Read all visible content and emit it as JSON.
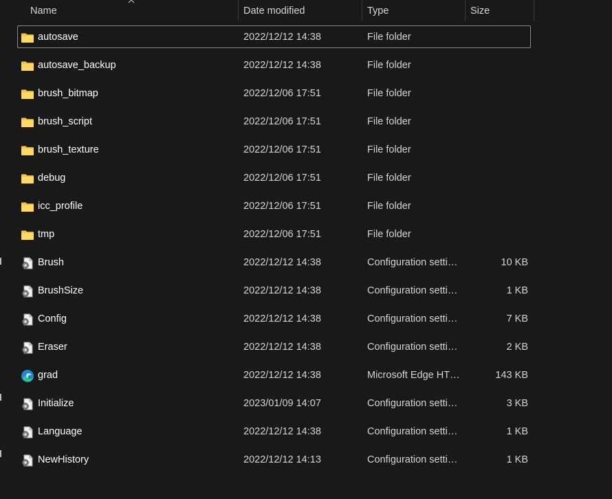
{
  "columns": {
    "name": "Name",
    "date": "Date modified",
    "type": "Type",
    "size": "Size"
  },
  "files": [
    {
      "name": "autosave",
      "date": "2022/12/12 14:38",
      "type": "File folder",
      "size": "",
      "icon": "folder-icon",
      "selected": true
    },
    {
      "name": "autosave_backup",
      "date": "2022/12/12 14:38",
      "type": "File folder",
      "size": "",
      "icon": "folder-icon"
    },
    {
      "name": "brush_bitmap",
      "date": "2022/12/06 17:51",
      "type": "File folder",
      "size": "",
      "icon": "folder-icon"
    },
    {
      "name": "brush_script",
      "date": "2022/12/06 17:51",
      "type": "File folder",
      "size": "",
      "icon": "folder-icon"
    },
    {
      "name": "brush_texture",
      "date": "2022/12/06 17:51",
      "type": "File folder",
      "size": "",
      "icon": "folder-icon"
    },
    {
      "name": "debug",
      "date": "2022/12/06 17:51",
      "type": "File folder",
      "size": "",
      "icon": "folder-icon"
    },
    {
      "name": "icc_profile",
      "date": "2022/12/06 17:51",
      "type": "File folder",
      "size": "",
      "icon": "folder-icon"
    },
    {
      "name": "tmp",
      "date": "2022/12/06 17:51",
      "type": "File folder",
      "size": "",
      "icon": "folder-icon"
    },
    {
      "name": "Brush",
      "date": "2022/12/12 14:38",
      "type": "Configuration setti…",
      "size": "10 KB",
      "icon": "config-settings-icon"
    },
    {
      "name": "BrushSize",
      "date": "2022/12/12 14:38",
      "type": "Configuration setti…",
      "size": "1 KB",
      "icon": "config-settings-icon"
    },
    {
      "name": "Config",
      "date": "2022/12/12 14:38",
      "type": "Configuration setti…",
      "size": "7 KB",
      "icon": "config-settings-icon"
    },
    {
      "name": "Eraser",
      "date": "2022/12/12 14:38",
      "type": "Configuration setti…",
      "size": "2 KB",
      "icon": "config-settings-icon"
    },
    {
      "name": "grad",
      "date": "2022/12/12 14:38",
      "type": "Microsoft Edge HT…",
      "size": "143 KB",
      "icon": "edge-html-icon"
    },
    {
      "name": "Initialize",
      "date": "2023/01/09 14:07",
      "type": "Configuration setti…",
      "size": "3 KB",
      "icon": "config-settings-icon"
    },
    {
      "name": "Language",
      "date": "2022/12/12 14:38",
      "type": "Configuration setti…",
      "size": "1 KB",
      "icon": "config-settings-icon"
    },
    {
      "name": "NewHistory",
      "date": "2022/12/12 14:13",
      "type": "Configuration setti…",
      "size": "1 KB",
      "icon": "config-settings-icon"
    }
  ],
  "colors": {
    "background": "#191919",
    "folder": "#f5c542",
    "edge_blue": "#1a8ad8",
    "edge_green": "#37c57a"
  }
}
